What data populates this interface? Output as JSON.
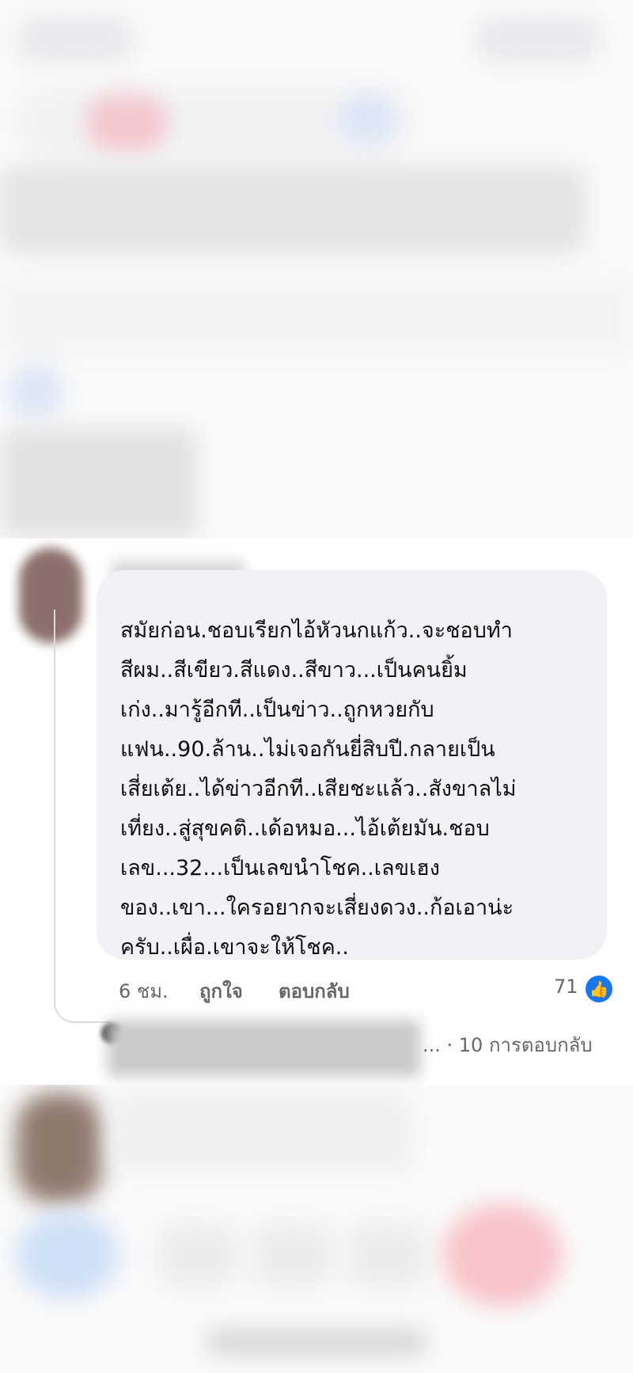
{
  "comment": {
    "text": "สมัยก่อน.ชอบเรียกไอ้หัวนกแก้ว..จะชอบทำสีผม..สีเขียว.สีแดง..สีขาว...เป็นคนยิ้มเก่ง..มารู้อีกที..เป็นข่าว..ถูกหวยกับแฟน..90.ล้าน..ไม่เจอกันยี่สิบปี.กลายเป็นเสี่ยเต้ย..ได้ข่าวอีกที..เสียชะแล้ว..สังขาลไม่เที่ยง..สู่สุขคติ..เด้อหมอ...ไอ้เต้ยมัน.ชอบเลข...32...เป็นเลขนำโชค..เลขเฮงของ..เขา...ใครอยากจะเสี่ยงดวง..ก้อเอาน่ะครับ..เผื่อ.เขาจะให้โชค..",
    "lines": [
      "สมัยก่อน.ชอบเรียกไอ้หัวนกแก้ว..จะชอบทำ",
      "สีผม..สีเขียว.สีแดง..สีขาว...เป็นคนยิ้ม",
      "เก่ง..มารู้อีกที..เป็นข่าว..ถูกหวยกับ",
      "แฟน..90.ล้าน..ไม่เจอกันยี่สิบปี.กลายเป็น",
      "เสี่ยเต้ย..ได้ข่าวอีกที..เสียชะแล้ว..สังขาลไม่",
      "เที่ยง..สู่สุขคติ..เด้อหมอ...ไอ้เต้ยมัน.ชอบ",
      "เลข...32...เป็นเลขนำโชค..เลขเฮง",
      "ของ..เขา...ใครอยากจะเสี่ยงดวง..ก้อเอาน่ะ",
      "ครับ..เผื่อ.เขาจะให้โชค.."
    ],
    "time": "6 ชม.",
    "like_label": "ถูกใจ",
    "reply_label": "ตอบกลับ",
    "like_count": "71",
    "replies_text": "... · 10 การตอบกลับ"
  },
  "colors": {
    "accent": "#1877f2",
    "bubble": "#f0f2f5",
    "meta": "#65676b"
  }
}
